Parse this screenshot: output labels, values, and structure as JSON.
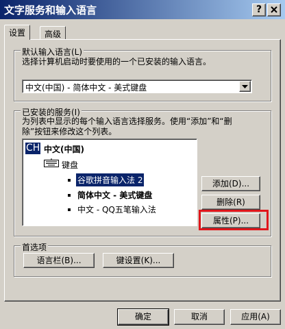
{
  "window": {
    "title": "文字服务和输入语言",
    "help_button": "?",
    "close_button": "X"
  },
  "tabs": [
    {
      "label": "设置"
    },
    {
      "label": "高级"
    }
  ],
  "default_language": {
    "group_title": "默认输入语言(L)",
    "description": "选择计算机启动时要使用的一个已安装的输入语言。",
    "selected_value": "中文(中国) - 简体中文 - 美式键盘"
  },
  "installed_services": {
    "group_title": "已安装的服务(I)",
    "description_line1": "为列表中显示的每个输入语言选择服务。使用“添加”和“删",
    "description_line2": "除”按钮来修改这个列表。",
    "language_code": "CH",
    "language_name": "中文(中国)",
    "category": "键盘",
    "items": [
      {
        "label": "谷歌拼音输入法 2",
        "selected": true
      },
      {
        "label": "简体中文 - 美式键盘",
        "bold": true
      },
      {
        "label": "中文 - QQ五笔输入法"
      }
    ],
    "add_label": "添加(D)...",
    "remove_label": "删除(R)",
    "properties_label": "属性(P)..."
  },
  "preferences": {
    "group_title": "首选项",
    "language_bar_label": "语言栏(B)...",
    "key_settings_label": "键设置(K)..."
  },
  "footer": {
    "ok_label": "确定",
    "cancel_label": "取消",
    "apply_label": "应用(A)"
  },
  "colors": {
    "titlebar_start": "#0a246a",
    "titlebar_end": "#a6caf0",
    "selection": "#0a246a",
    "highlight_annotation": "#e0161b",
    "face": "#d4d0c8"
  }
}
